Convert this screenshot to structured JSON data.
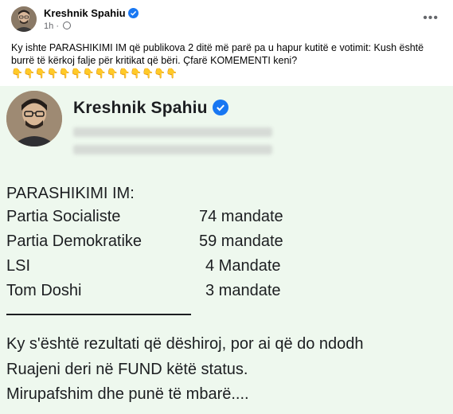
{
  "post": {
    "author": "Kreshnik Spahiu",
    "time": "1h",
    "caption": "Ky ishte PARASHIKIMI IM që publikova 2 ditë më parë pa u hapur kutitë e votimit: Kush është burrë të kërkoj falje për kritikat që bëri. Çfarë KOMEMENTI keni?",
    "emojis": "👇👇👇👇👇👇👇👇👇👇👇👇👇👇"
  },
  "image": {
    "name": "Kreshnik Spahiu",
    "prediction_title": "PARASHIKIMI IM:",
    "rows": [
      {
        "party": "Partia Socialiste",
        "seats": "74 mandate"
      },
      {
        "party": "Partia Demokratike",
        "seats": "59 mandate"
      },
      {
        "party": "LSI",
        "seats": "4 Mandate"
      },
      {
        "party": "Tom Doshi",
        "seats": "3 mandate"
      }
    ],
    "line1": "Ky s'është rezultati që dëshiroj, por ai që do ndodh",
    "line2": "Ruajeni deri në FUND këtë status.",
    "line3": "Mirupafshim dhe punë të mbarë...."
  },
  "colors": {
    "verified": "#1877f2",
    "panel_bg": "#eef8ee"
  }
}
